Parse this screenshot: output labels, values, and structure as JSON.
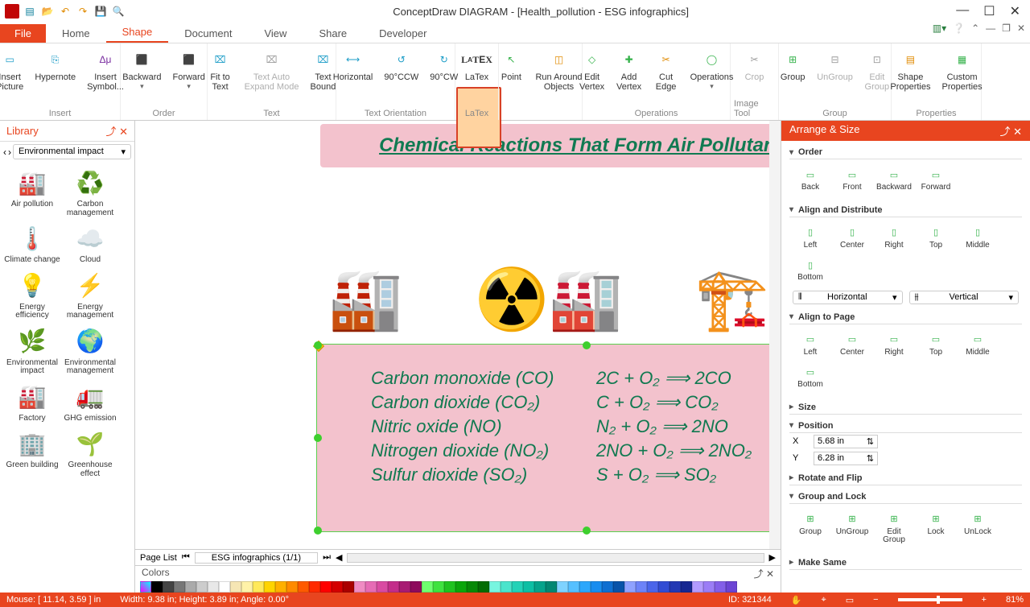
{
  "app": {
    "title": "ConceptDraw DIAGRAM - [Health_pollution - ESG infographics]"
  },
  "menubar": {
    "file": "File",
    "tabs": [
      "Home",
      "Shape",
      "Document",
      "View",
      "Share",
      "Developer"
    ],
    "active": 1
  },
  "ribbon": {
    "groups": {
      "insert": {
        "label": "Insert",
        "btns": [
          {
            "n": "Insert\nPicture"
          },
          {
            "n": "Hypernote"
          },
          {
            "n": "Insert\nSymbol..."
          }
        ]
      },
      "order": {
        "label": "Order",
        "btns": [
          {
            "n": "Backward"
          },
          {
            "n": "Forward"
          }
        ]
      },
      "text": {
        "label": "Text",
        "btns": [
          {
            "n": "Fit to\nText"
          },
          {
            "n": "Text Auto\nExpand Mode",
            "disabled": true
          },
          {
            "n": "Text\nBound"
          }
        ]
      },
      "orient": {
        "label": "Text Orientation",
        "btns": [
          {
            "n": "Horizontal"
          },
          {
            "n": "90°CCW"
          },
          {
            "n": "90°CW"
          }
        ]
      },
      "latex": {
        "label": "LaTex",
        "btns": [
          {
            "n": "LaTex"
          }
        ]
      },
      "misc": {
        "btns": [
          {
            "n": "Point"
          },
          {
            "n": "Run Around\nObjects"
          }
        ]
      },
      "ops": {
        "label": "Operations",
        "btns": [
          {
            "n": "Edit\nVertex"
          },
          {
            "n": "Add\nVertex"
          },
          {
            "n": "Cut\nEdge"
          },
          {
            "n": "Operations"
          }
        ]
      },
      "image": {
        "label": "Image Tool",
        "btns": [
          {
            "n": "Crop",
            "disabled": true
          }
        ]
      },
      "group": {
        "label": "Group",
        "btns": [
          {
            "n": "Group"
          },
          {
            "n": "UnGroup",
            "disabled": true
          },
          {
            "n": "Edit\nGroup",
            "disabled": true
          }
        ]
      },
      "props": {
        "label": "Properties",
        "btns": [
          {
            "n": "Shape\nProperties"
          },
          {
            "n": "Custom\nProperties"
          }
        ]
      }
    }
  },
  "library": {
    "title": "Library",
    "selector": "Environmental impact",
    "items": [
      {
        "n": "Air pollution"
      },
      {
        "n": "Carbon management"
      },
      {
        "n": "Climate change"
      },
      {
        "n": "Cloud"
      },
      {
        "n": "Energy efficiency"
      },
      {
        "n": "Energy management"
      },
      {
        "n": "Environmental impact"
      },
      {
        "n": "Environmental management"
      },
      {
        "n": "Factory"
      },
      {
        "n": "GHG emission"
      },
      {
        "n": "Green building"
      },
      {
        "n": "Greenhouse effect"
      }
    ]
  },
  "canvas": {
    "title": "Chemical Reactions That Form Air Pollutants",
    "formulas": [
      {
        "name": "Carbon monoxide (CO)",
        "eq": "2C + O₂ ⟹ 2CO"
      },
      {
        "name": "Carbon dioxide (CO₂)",
        "eq": "C + O₂ ⟹ CO₂"
      },
      {
        "name": "Nitric oxide (NO)",
        "eq": "N₂ + O₂ ⟹ 2NO"
      },
      {
        "name": "Nitrogen dioxide (NO₂)",
        "eq": "2NO + O₂ ⟹ 2NO₂"
      },
      {
        "name": "Sulfur dioxide (SO₂)",
        "eq": "S + O₂ ⟹ SO₂"
      }
    ],
    "pagelist": "Page List",
    "pagename": "ESG infographics (1/1)",
    "colors_label": "Colors"
  },
  "arrange": {
    "title": "Arrange & Size",
    "order": {
      "label": "Order",
      "btns": [
        "Back",
        "Front",
        "Backward",
        "Forward"
      ]
    },
    "align": {
      "label": "Align and Distribute",
      "btns": [
        "Left",
        "Center",
        "Right",
        "Top",
        "Middle",
        "Bottom"
      ],
      "sel1": "Horizontal",
      "sel2": "Vertical"
    },
    "alignpage": {
      "label": "Align to Page",
      "btns": [
        "Left",
        "Center",
        "Right",
        "Top",
        "Middle",
        "Bottom"
      ]
    },
    "size": {
      "label": "Size"
    },
    "pos": {
      "label": "Position",
      "x_label": "X",
      "x": "5.68 in",
      "y_label": "Y",
      "y": "6.28 in"
    },
    "rotate": {
      "label": "Rotate and Flip"
    },
    "grouplock": {
      "label": "Group and Lock",
      "btns": [
        "Group",
        "UnGroup",
        "Edit Group",
        "Lock",
        "UnLock"
      ]
    },
    "makesame": {
      "label": "Make Same"
    }
  },
  "status": {
    "mouse": "Mouse: [ 11.14, 3.59 ] in",
    "dims": "Width: 9.38 in;  Height: 3.89 in;  Angle: 0.00°",
    "id": "ID: 321344",
    "zoom": "81%"
  },
  "colors": [
    "#000",
    "#444",
    "#777",
    "#aaa",
    "#ccc",
    "#e8e8e8",
    "#fff",
    "#f6e6b4",
    "#fff2a8",
    "#ffe95a",
    "#ffd400",
    "#ffb000",
    "#ff8a00",
    "#ff5a00",
    "#ff2a00",
    "#ff0000",
    "#d40000",
    "#aa0000",
    "#f08bc3",
    "#e66bb5",
    "#d94aa2",
    "#c32d8a",
    "#a81b73",
    "#8d0a5c",
    "#6fff6f",
    "#3fe23f",
    "#1fc31f",
    "#0aa60a",
    "#068906",
    "#036c03",
    "#77f5e0",
    "#4be4cc",
    "#23d2b7",
    "#0dbfa4",
    "#05a38b",
    "#028772",
    "#7fd3ff",
    "#56c0ff",
    "#2da7fb",
    "#198def",
    "#0f6fd1",
    "#0853a9",
    "#8fa2ff",
    "#6d83f8",
    "#4b65ea",
    "#324cd4",
    "#2338b4",
    "#162792",
    "#b39bff",
    "#9b7df6",
    "#835fe8",
    "#6c45d4",
    "#5731ba",
    "#44219a",
    "#d39bff",
    "#c07de9",
    "#a85fce",
    "#8d45b0",
    "#733190",
    "#5b2172",
    "#999",
    "#bbb",
    "#ddd",
    "#333"
  ]
}
